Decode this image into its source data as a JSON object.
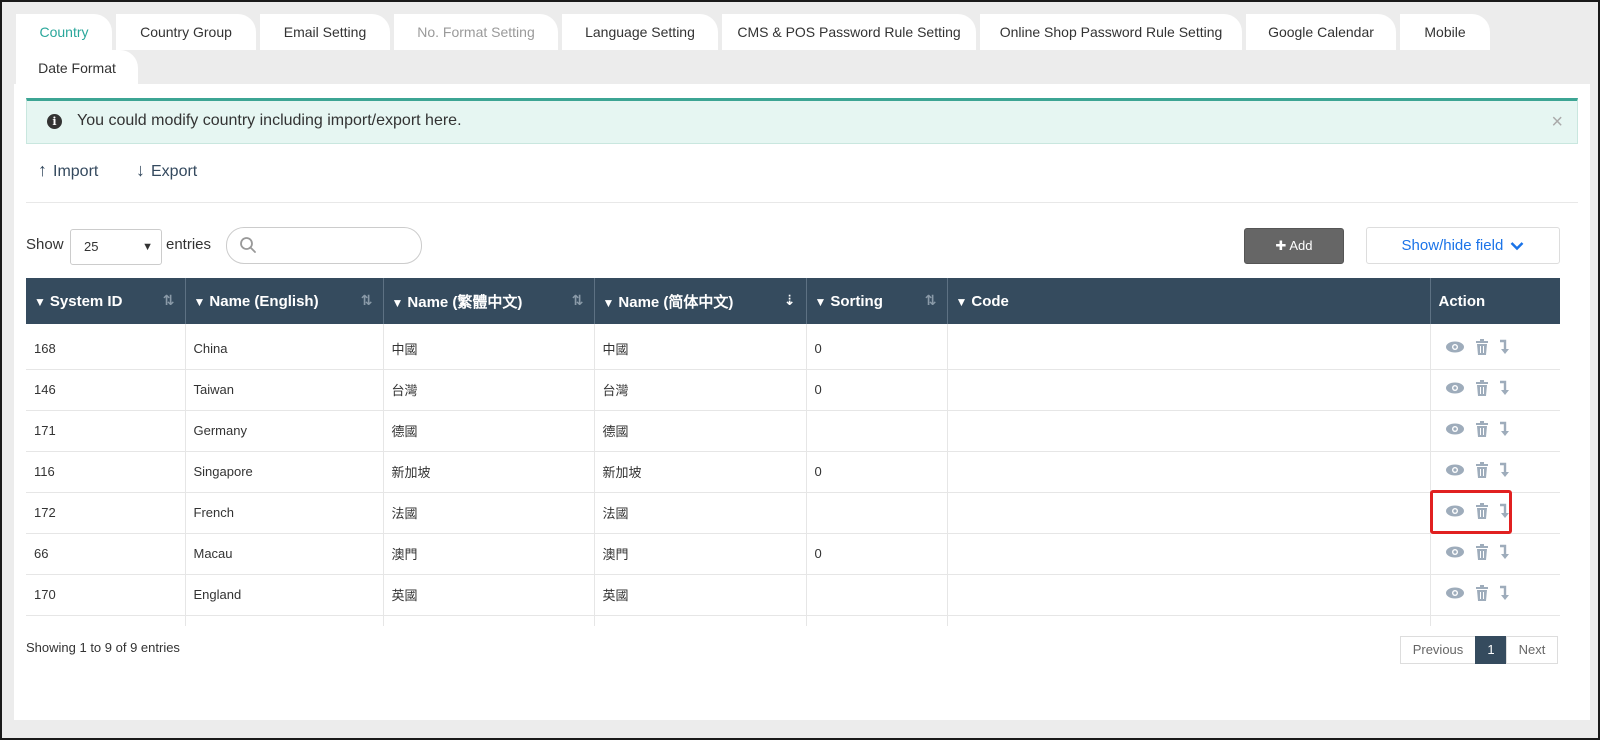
{
  "tabs": [
    {
      "label": "Country",
      "state": "active"
    },
    {
      "label": "Country Group",
      "state": "normal"
    },
    {
      "label": "Email Setting",
      "state": "normal"
    },
    {
      "label": "No. Format Setting",
      "state": "disabled"
    },
    {
      "label": "Language Setting",
      "state": "normal"
    },
    {
      "label": "CMS & POS Password Rule Setting",
      "state": "normal"
    },
    {
      "label": "Online Shop Password Rule Setting",
      "state": "normal"
    },
    {
      "label": "Google Calendar",
      "state": "normal"
    },
    {
      "label": "Mobile",
      "state": "normal"
    },
    {
      "label": "Date Format",
      "state": "normal"
    }
  ],
  "alert": {
    "text": "You could modify country including import/export here.",
    "close": "×"
  },
  "toolbar": {
    "import_label": "Import",
    "export_label": "Export"
  },
  "controls": {
    "show_label": "Show",
    "entries_value": "25",
    "entries_label": "entries",
    "search_placeholder": "",
    "add_label": "Add",
    "showhide_label": "Show/hide field"
  },
  "table": {
    "headers": [
      "System ID",
      "Name (English)",
      "Name (繁體中文)",
      "Name (简体中文)",
      "Sorting",
      "Code",
      "Action"
    ],
    "rows": [
      [
        "168",
        "China",
        "中國",
        "中國",
        "0",
        ""
      ],
      [
        "146",
        "Taiwan",
        "台灣",
        "台灣",
        "0",
        ""
      ],
      [
        "171",
        "Germany",
        "德國",
        "德國",
        "",
        ""
      ],
      [
        "116",
        "Singapore",
        "新加坡",
        "新加坡",
        "0",
        ""
      ],
      [
        "172",
        "French",
        "法國",
        "法國",
        "",
        ""
      ],
      [
        "66",
        "Macau",
        "澳門",
        "澳門",
        "0",
        ""
      ],
      [
        "170",
        "England",
        "英國",
        "英國",
        "",
        ""
      ],
      [
        "",
        "",
        "",
        "",
        "",
        ""
      ]
    ]
  },
  "footer": {
    "showing": "Showing 1 to 9 of 9 entries",
    "prev_label": "Previous",
    "current_page": "1",
    "next_label": "Next"
  },
  "colors": {
    "accent": "#2aa79b",
    "header_bg": "#354b5e",
    "highlight": "#e12020"
  }
}
